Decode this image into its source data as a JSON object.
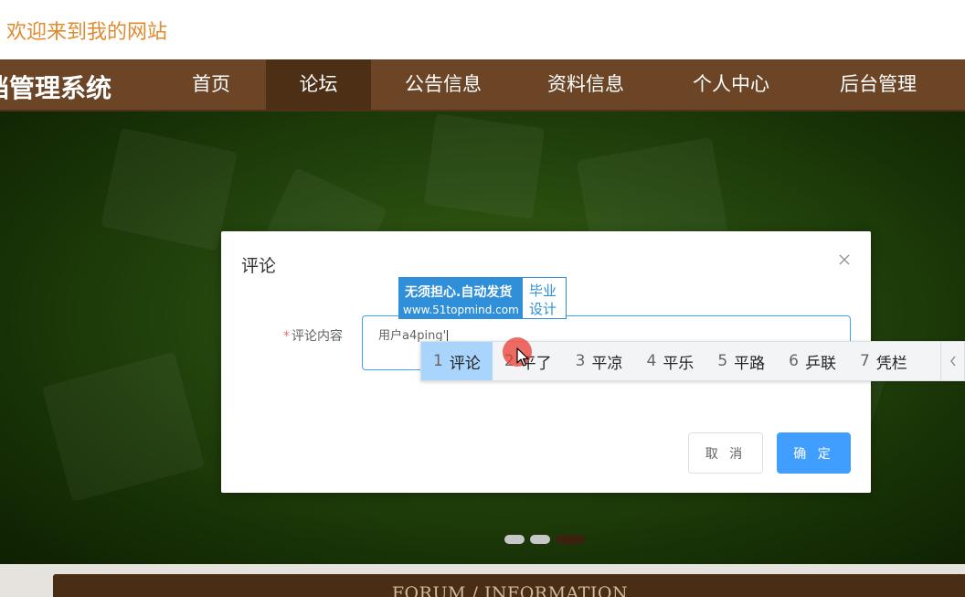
{
  "header": {
    "welcome": "欢迎来到我的网站"
  },
  "nav": {
    "site_title": "档管理系统",
    "items": [
      {
        "label": "首页"
      },
      {
        "label": "论坛"
      },
      {
        "label": "公告信息"
      },
      {
        "label": "资料信息"
      },
      {
        "label": "个人中心"
      },
      {
        "label": "后台管理"
      }
    ],
    "active_index": 1
  },
  "carousel": {
    "dot_count": 3,
    "active_index": 2
  },
  "section": {
    "title": "FORUM / INFORMATION"
  },
  "dialog": {
    "title": "评论",
    "close_icon": "close-icon",
    "field_required_mark": "*",
    "field_label": "评论内容",
    "field_value": "用户a4ping'",
    "cancel_label": "取 消",
    "confirm_label": "确 定"
  },
  "watermark": {
    "main": "无须担心.自动发货",
    "url": "www.51topmind.com",
    "right_line1": "毕业",
    "right_line2": "设计"
  },
  "ime": {
    "candidates": [
      {
        "num": "1",
        "text": "评论"
      },
      {
        "num": "2",
        "text": "平了"
      },
      {
        "num": "3",
        "text": "平凉"
      },
      {
        "num": "4",
        "text": "平乐"
      },
      {
        "num": "5",
        "text": "平路"
      },
      {
        "num": "6",
        "text": "乒联"
      },
      {
        "num": "7",
        "text": "凭栏"
      }
    ],
    "selected_index": 0,
    "prev_icon": "chevron-left-icon"
  },
  "colors": {
    "welcome": "#e08a2e",
    "nav_bg": "#6b4526",
    "nav_active": "#4d2f16",
    "primary": "#409eff",
    "required": "#f56c6c",
    "watermark": "#2f8fd8",
    "ime_selected": "#a9d4fb"
  }
}
